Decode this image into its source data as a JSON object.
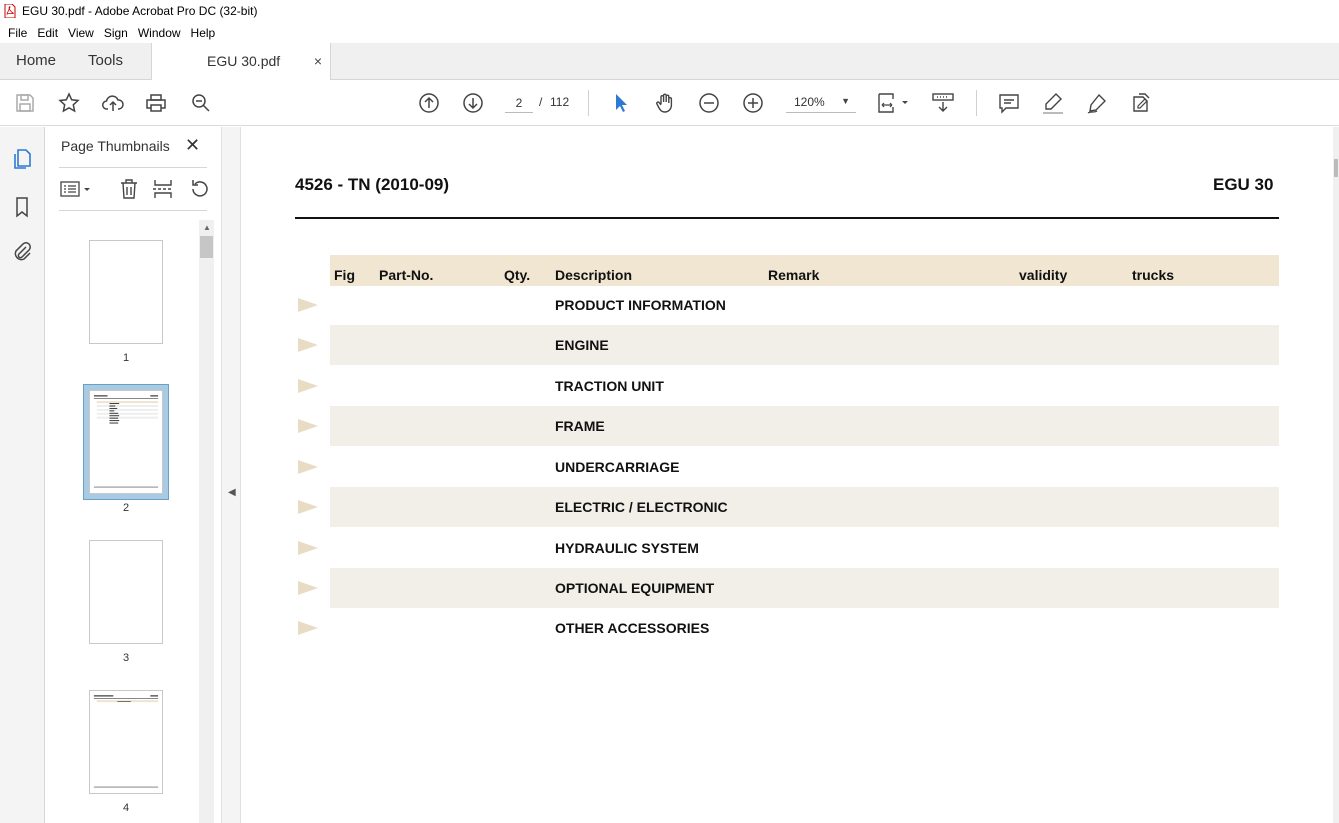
{
  "window": {
    "title": "EGU 30.pdf - Adobe Acrobat Pro DC (32-bit)"
  },
  "menu": [
    "File",
    "Edit",
    "View",
    "Sign",
    "Window",
    "Help"
  ],
  "tabs": {
    "home": "Home",
    "tools": "Tools",
    "document": "EGU 30.pdf",
    "close": "×"
  },
  "toolbar": {
    "page_current": "2",
    "page_separator": "/",
    "page_total": "112",
    "zoom": "120%"
  },
  "sidebar": {
    "title": "Page Thumbnails",
    "thumbnails": [
      {
        "page": "1"
      },
      {
        "page": "2",
        "selected": true
      },
      {
        "page": "3"
      },
      {
        "page": "4"
      }
    ]
  },
  "document": {
    "header_left": "4526 - TN (2010-09)",
    "header_right": "EGU 30",
    "columns": [
      "Fig",
      "Part-No.",
      "Qty.",
      "Description",
      "Remark",
      "validity",
      "trucks"
    ],
    "rows": [
      "PRODUCT INFORMATION",
      "ENGINE",
      "TRACTION UNIT",
      "FRAME",
      "UNDERCARRIAGE",
      "ELECTRIC / ELECTRONIC",
      "HYDRAULIC SYSTEM",
      "OPTIONAL EQUIPMENT",
      "OTHER ACCESSORIES"
    ]
  },
  "colors": {
    "header_band": "#f0e6d2",
    "row_alt": "#f1efe8",
    "row_arrow": "#e8dcc4",
    "select_blue": "#2d7ad4",
    "thumb_selected": "#a8cbe3"
  }
}
